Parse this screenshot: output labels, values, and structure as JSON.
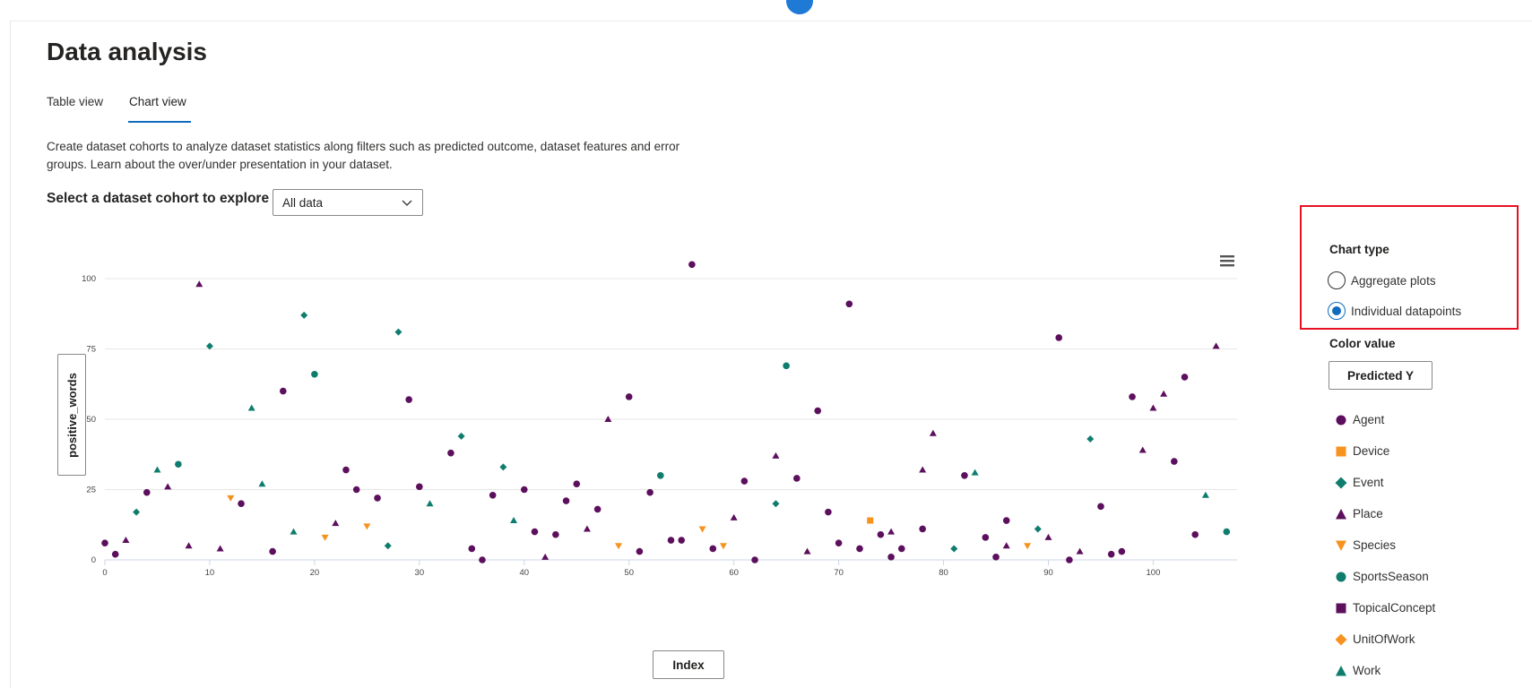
{
  "page": {
    "title": "Data analysis",
    "tabs": [
      {
        "label": "Table view"
      },
      {
        "label": "Chart view"
      }
    ],
    "description": "Create dataset cohorts to analyze dataset statistics along filters such as predicted outcome, dataset features and error groups. Learn about the over/under presentation in your dataset.",
    "cohort_label": "Select a dataset cohort to explore",
    "cohort_value": "All data"
  },
  "side": {
    "chart_type_label": "Chart type",
    "option_aggregate": "Aggregate plots",
    "option_individual": "Individual datapoints",
    "color_value_label": "Color value",
    "color_button": "Predicted Y"
  },
  "colors": {
    "purple": "#5c0f5c",
    "orange": "#f7921e",
    "teal": "#0f7d6d",
    "accent": "#0f6cbd",
    "highlight": "#e81123"
  },
  "chart_data": {
    "type": "scatter",
    "xlabel": "Index",
    "ylabel": "positive_words",
    "xlim": [
      0,
      108
    ],
    "ylim": [
      0,
      100
    ],
    "xticks": [
      0,
      10,
      20,
      30,
      40,
      50,
      60,
      70,
      80,
      90,
      100
    ],
    "yticks": [
      0,
      25,
      50,
      75,
      100
    ],
    "grid": true,
    "series": [
      {
        "name": "Agent",
        "marker": "circle",
        "color": "#5c0f5c",
        "points": [
          [
            0,
            6
          ],
          [
            1,
            2
          ],
          [
            4,
            24
          ],
          [
            13,
            20
          ],
          [
            16,
            3
          ],
          [
            17,
            60
          ],
          [
            23,
            32
          ],
          [
            24,
            25
          ],
          [
            26,
            22
          ],
          [
            29,
            57
          ],
          [
            30,
            26
          ],
          [
            33,
            38
          ],
          [
            35,
            4
          ],
          [
            36,
            0
          ],
          [
            37,
            23
          ],
          [
            40,
            25
          ],
          [
            41,
            10
          ],
          [
            43,
            9
          ],
          [
            44,
            21
          ],
          [
            45,
            27
          ],
          [
            47,
            18
          ],
          [
            50,
            58
          ],
          [
            51,
            3
          ],
          [
            52,
            24
          ],
          [
            54,
            7
          ],
          [
            55,
            7
          ],
          [
            56,
            105
          ],
          [
            58,
            4
          ],
          [
            61,
            28
          ],
          [
            62,
            0
          ],
          [
            66,
            29
          ],
          [
            68,
            53
          ],
          [
            69,
            17
          ],
          [
            70,
            6
          ],
          [
            71,
            91
          ],
          [
            72,
            4
          ],
          [
            74,
            9
          ],
          [
            75,
            1
          ],
          [
            76,
            4
          ],
          [
            78,
            11
          ],
          [
            82,
            30
          ],
          [
            84,
            8
          ],
          [
            85,
            1
          ],
          [
            86,
            14
          ],
          [
            91,
            79
          ],
          [
            92,
            0
          ],
          [
            95,
            19
          ],
          [
            96,
            2
          ],
          [
            97,
            3
          ],
          [
            98,
            58
          ],
          [
            102,
            35
          ],
          [
            103,
            65
          ],
          [
            104,
            9
          ]
        ]
      },
      {
        "name": "Device",
        "marker": "square",
        "color": "#f7921e",
        "points": [
          [
            73,
            14
          ]
        ]
      },
      {
        "name": "Event",
        "marker": "diamond",
        "color": "#0f7d6d",
        "points": [
          [
            3,
            17
          ],
          [
            10,
            76
          ],
          [
            19,
            87
          ],
          [
            27,
            5
          ],
          [
            28,
            81
          ],
          [
            34,
            44
          ],
          [
            38,
            33
          ],
          [
            64,
            20
          ],
          [
            81,
            4
          ],
          [
            89,
            11
          ],
          [
            94,
            43
          ]
        ]
      },
      {
        "name": "Place",
        "marker": "triangle-up",
        "color": "#5c0f5c",
        "points": [
          [
            2,
            7
          ],
          [
            6,
            26
          ],
          [
            8,
            5
          ],
          [
            9,
            98
          ],
          [
            11,
            4
          ],
          [
            22,
            13
          ],
          [
            42,
            1
          ],
          [
            46,
            11
          ],
          [
            48,
            50
          ],
          [
            60,
            15
          ],
          [
            64,
            37
          ],
          [
            67,
            3
          ],
          [
            75,
            10
          ],
          [
            78,
            32
          ],
          [
            79,
            45
          ],
          [
            86,
            5
          ],
          [
            90,
            8
          ],
          [
            93,
            3
          ],
          [
            99,
            39
          ],
          [
            100,
            54
          ],
          [
            101,
            59
          ],
          [
            106,
            76
          ]
        ]
      },
      {
        "name": "Species",
        "marker": "triangle-down",
        "color": "#f7921e",
        "points": [
          [
            12,
            22
          ],
          [
            21,
            8
          ],
          [
            25,
            12
          ],
          [
            49,
            5
          ],
          [
            57,
            11
          ],
          [
            59,
            5
          ],
          [
            88,
            5
          ]
        ]
      },
      {
        "name": "SportsSeason",
        "marker": "circle",
        "color": "#0f7d6d",
        "points": [
          [
            7,
            34
          ],
          [
            20,
            66
          ],
          [
            53,
            30
          ],
          [
            65,
            69
          ],
          [
            107,
            10
          ]
        ]
      },
      {
        "name": "TopicalConcept",
        "marker": "square",
        "color": "#5c0f5c",
        "points": []
      },
      {
        "name": "UnitOfWork",
        "marker": "diamond",
        "color": "#f7921e",
        "points": []
      },
      {
        "name": "Work",
        "marker": "triangle-up",
        "color": "#0f7d6d",
        "points": [
          [
            5,
            32
          ],
          [
            14,
            54
          ],
          [
            15,
            27
          ],
          [
            18,
            10
          ],
          [
            31,
            20
          ],
          [
            39,
            14
          ],
          [
            83,
            31
          ],
          [
            105,
            23
          ]
        ]
      }
    ]
  }
}
